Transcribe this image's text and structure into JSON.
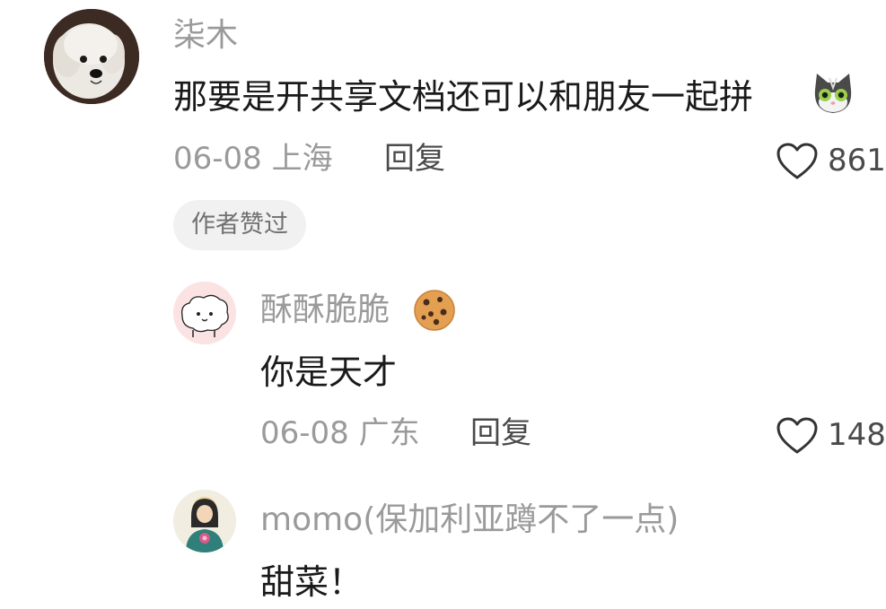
{
  "comments": [
    {
      "username": "柒木",
      "text": "那要是开共享文档还可以和朋友一起拼",
      "meta": "06-08 上海",
      "reply_label": "回复",
      "likes": "861",
      "badge": "作者赞过"
    },
    {
      "username": "酥酥脆脆",
      "text": "你是天才",
      "meta": "06-08 广东",
      "reply_label": "回复",
      "likes": "148"
    },
    {
      "username": "momo(保加利亚蹲不了一点)",
      "text": "甜菜！"
    }
  ],
  "icons": {
    "like": "heart-outline-icon",
    "emoji_cat": "cat-emoji",
    "emoji_cookie": "cookie-emoji"
  },
  "colors": {
    "username": "#9a9a9a",
    "text": "#1a1a1a",
    "meta": "#9a9a9a",
    "reply": "#4a4a4a",
    "badge_bg": "#f1f1f1"
  }
}
